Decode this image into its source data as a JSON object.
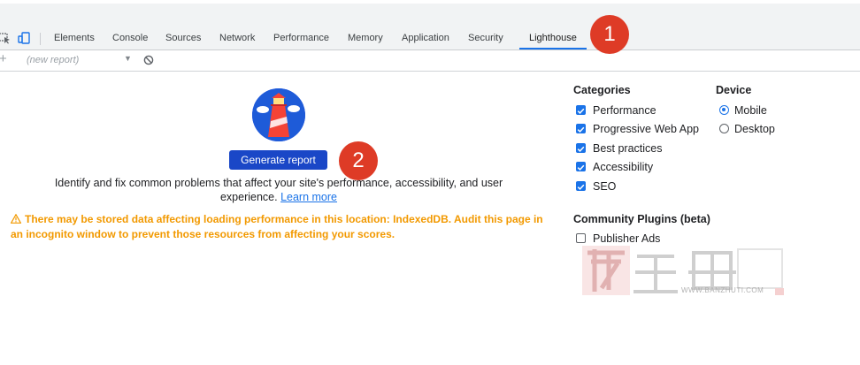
{
  "tabs": [
    {
      "label": "Elements",
      "active": false
    },
    {
      "label": "Console",
      "active": false
    },
    {
      "label": "Sources",
      "active": false
    },
    {
      "label": "Network",
      "active": false
    },
    {
      "label": "Performance",
      "active": false
    },
    {
      "label": "Memory",
      "active": false
    },
    {
      "label": "Application",
      "active": false
    },
    {
      "label": "Security",
      "active": false
    },
    {
      "label": "Lighthouse",
      "active": true
    }
  ],
  "toolbar": {
    "report_select": "(new report)",
    "icons": [
      "plus-icon",
      "dropdown-caret-icon",
      "clear-icon"
    ]
  },
  "main": {
    "generate_button": "Generate report",
    "description": "Identify and fix common problems that affect your site's performance, accessibility, and user experience.",
    "learn_more": "Learn more",
    "warning": "There may be stored data affecting loading performance in this location: IndexedDB. Audit this page in an incognito window to prevent those resources from affecting your scores."
  },
  "categories": {
    "title": "Categories",
    "items": [
      {
        "label": "Performance",
        "checked": true
      },
      {
        "label": "Progressive Web App",
        "checked": true
      },
      {
        "label": "Best practices",
        "checked": true
      },
      {
        "label": "Accessibility",
        "checked": true
      },
      {
        "label": "SEO",
        "checked": true
      }
    ]
  },
  "device": {
    "title": "Device",
    "options": [
      {
        "label": "Mobile",
        "selected": true
      },
      {
        "label": "Desktop",
        "selected": false
      }
    ]
  },
  "plugins": {
    "title": "Community Plugins (beta)",
    "items": [
      {
        "label": "Publisher Ads",
        "checked": false
      }
    ]
  },
  "annotations": [
    "1",
    "2"
  ],
  "watermark": {
    "text": "WWW.BANZHUTI.COM",
    "glyphs": "主 题"
  },
  "colors": {
    "accent": "#1a73e8",
    "button": "#1a47c7",
    "warning": "#f29900",
    "badge": "#de3b26"
  }
}
